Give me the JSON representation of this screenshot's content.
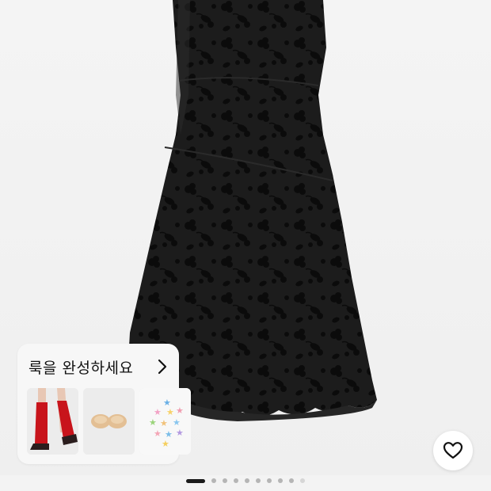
{
  "product": {
    "image_alt": "black floral flocked mesh mini dress"
  },
  "lookbook": {
    "title": "룩을 완성하세요",
    "chevron_icon": "chevron-right-icon",
    "items": [
      {
        "name": "red leg warmers"
      },
      {
        "name": "nude silicone bra pads"
      },
      {
        "name": "star hair clips"
      }
    ]
  },
  "wishlist": {
    "icon": "heart-icon"
  },
  "pager": {
    "total": 10,
    "current": 1
  },
  "colors": {
    "dress": "#141414",
    "background": "#f3f3f3",
    "accent_red": "#c8141b"
  }
}
